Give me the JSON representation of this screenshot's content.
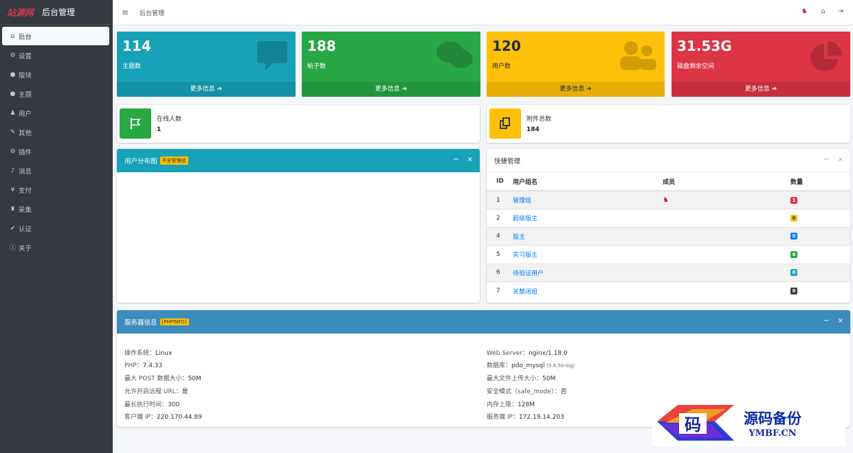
{
  "brand": {
    "logo": "站源网",
    "title": "后台管理"
  },
  "sidebar": {
    "items": [
      {
        "label": "后台",
        "icon": "home-icon",
        "glyph": "⌂"
      },
      {
        "label": "设置",
        "icon": "gear-icon",
        "glyph": "⚙"
      },
      {
        "label": "版块",
        "icon": "comment-icon",
        "glyph": "●"
      },
      {
        "label": "主题",
        "icon": "comment-icon",
        "glyph": "●"
      },
      {
        "label": "用户",
        "icon": "user-icon",
        "glyph": "♟"
      },
      {
        "label": "其他",
        "icon": "wrench-icon",
        "glyph": "✎"
      },
      {
        "label": "插件",
        "icon": "gears-icon",
        "glyph": "⚙"
      },
      {
        "label": "消息",
        "icon": "bell-icon",
        "glyph": "♪"
      },
      {
        "label": "支付",
        "icon": "yen-icon",
        "glyph": "¥"
      },
      {
        "label": "采集",
        "icon": "sitemap-icon",
        "glyph": "♜"
      },
      {
        "label": "认证",
        "icon": "check-icon",
        "glyph": "✔"
      },
      {
        "label": "关于",
        "icon": "info-circle-icon",
        "glyph": "ⓘ"
      }
    ]
  },
  "topbar": {
    "menu_glyph": "≡",
    "breadcrumb": "后台管理",
    "home_glyph": "⌂",
    "logout_glyph": "⇥",
    "avatar_glyph": "♞"
  },
  "stats": [
    {
      "value": "114",
      "label": "主题数",
      "more": "更多信息 ➔",
      "icon": "comment-square-icon",
      "glyph": "▬"
    },
    {
      "value": "188",
      "label": "帖子数",
      "more": "更多信息 ➔",
      "icon": "comments-icon",
      "glyph": "●"
    },
    {
      "value": "120",
      "label": "用户数",
      "more": "更多信息 ➔",
      "icon": "users-icon",
      "glyph": "♟♟"
    },
    {
      "value": "31.53G",
      "label": "磁盘剩余空间",
      "more": "更多信息 ➔",
      "icon": "pie-chart-icon",
      "glyph": "◕"
    }
  ],
  "info_boxes": [
    {
      "title": "在线人数",
      "value": "1",
      "icon": "flag-icon",
      "glyph": "⚐"
    },
    {
      "title": "附件总数",
      "value": "184",
      "icon": "copy-icon",
      "glyph": "❐"
    }
  ],
  "user_dist": {
    "title": "用户分布图",
    "badge": "不含管理组",
    "min_glyph": "−",
    "close_glyph": "×"
  },
  "quick": {
    "title": "快捷管理",
    "min_glyph": "−",
    "close_glyph": "×",
    "headers": [
      "ID",
      "用户组名",
      "成员",
      "数量"
    ],
    "rows": [
      {
        "id": "1",
        "name": "管理组",
        "member": "♞",
        "count": "1",
        "color": "#dc3545"
      },
      {
        "id": "2",
        "name": "超级版主",
        "member": "",
        "count": "0",
        "color": "#ffc107"
      },
      {
        "id": "4",
        "name": "版主",
        "member": "",
        "count": "0",
        "color": "#007bff"
      },
      {
        "id": "5",
        "name": "实习版主",
        "member": "",
        "count": "0",
        "color": "#28a745"
      },
      {
        "id": "6",
        "name": "待验证用户",
        "member": "",
        "count": "0",
        "color": "#17a2b8"
      },
      {
        "id": "7",
        "name": "关禁闭组",
        "member": "",
        "count": "0",
        "color": "#343a40"
      }
    ]
  },
  "server": {
    "title": "服务器信息",
    "badge": "[PHPINFO]",
    "min_glyph": "−",
    "close_glyph": "×",
    "left": [
      {
        "k": "操作系统：",
        "v": "Linux"
      },
      {
        "k": "PHP：",
        "v": "7.4.33"
      },
      {
        "k": "最大 POST 数据大小：",
        "v": "50M"
      },
      {
        "k": "允许开启远程 URL：",
        "v": "是"
      },
      {
        "k": "最长执行时间：",
        "v": "300"
      },
      {
        "k": "客户端 IP：",
        "v": "220.170.44.89"
      }
    ],
    "right": [
      {
        "k": "Web Server：",
        "v": "nginx/1.18.0",
        "extra": ""
      },
      {
        "k": "数据库：",
        "v": "pdo_mysql",
        "extra": "(5.6.50-log)"
      },
      {
        "k": "最大文件上传大小：",
        "v": "50M",
        "extra": ""
      },
      {
        "k": "安全模式（safe_mode）：",
        "v": "否",
        "extra": ""
      },
      {
        "k": "内存上限：",
        "v": "128M",
        "extra": ""
      },
      {
        "k": "服务端 IP：",
        "v": "172.19.14.203",
        "extra": ""
      }
    ]
  },
  "watermark": {
    "logo_char": "码",
    "line1": "源码备份",
    "line2": "YMBF.CN"
  },
  "colors": {
    "sidebar": "#343a40",
    "teal": "#17a2b8",
    "green": "#28a745",
    "yellow": "#ffc107",
    "red": "#dc3545",
    "server_head": "#3c8dbc"
  }
}
